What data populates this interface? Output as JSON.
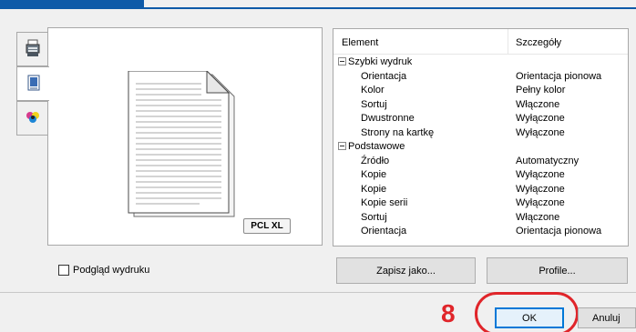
{
  "side_tabs": [
    {
      "icon": "printer-icon"
    },
    {
      "icon": "document-icon"
    },
    {
      "icon": "color-icon"
    }
  ],
  "preview": {
    "badge": "PCL XL"
  },
  "list": {
    "col_element": "Element",
    "col_details": "Szczegóły",
    "rows": [
      {
        "type": "group",
        "element": "Szybki wydruk",
        "value": ""
      },
      {
        "type": "child",
        "element": "Orientacja",
        "value": "Orientacja pionowa"
      },
      {
        "type": "child",
        "element": "Kolor",
        "value": "Pełny kolor"
      },
      {
        "type": "child",
        "element": "Sortuj",
        "value": "Włączone"
      },
      {
        "type": "child",
        "element": "Dwustronne",
        "value": "Wyłączone"
      },
      {
        "type": "child",
        "element": "Strony na kartkę",
        "value": "Wyłączone"
      },
      {
        "type": "group",
        "element": "Podstawowe",
        "value": ""
      },
      {
        "type": "child",
        "element": "Źródło",
        "value": "Automatyczny"
      },
      {
        "type": "child",
        "element": "Kopie",
        "value": "Wyłączone"
      },
      {
        "type": "child",
        "element": "Kopie",
        "value": "Wyłączone"
      },
      {
        "type": "child",
        "element": "Kopie serii",
        "value": "Wyłączone"
      },
      {
        "type": "child",
        "element": "Sortuj",
        "value": "Włączone"
      },
      {
        "type": "child",
        "element": "Orientacja",
        "value": "Orientacja pionowa"
      }
    ]
  },
  "print_preview_checkbox": {
    "label": "Podgląd wydruku",
    "checked": false
  },
  "buttons": {
    "save_as": "Zapisz jako...",
    "profile": "Profile...",
    "ok": "OK",
    "cancel": "Anuluj"
  },
  "annotation": {
    "step": "8",
    "color": "#e0252a"
  },
  "colors": {
    "accent": "#0e5aa8",
    "ok_border": "#0078d7"
  }
}
